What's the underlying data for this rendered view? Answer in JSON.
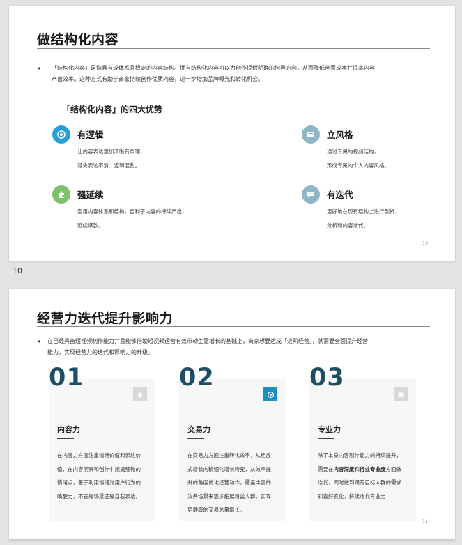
{
  "slide1": {
    "title": "做结构化内容",
    "bullet": "•",
    "paragraph_line1": "「结构化内容」是指具有成体系且稳定的内容结构。拥有结构化内容可以为创作提供明确的指导方向，从而降低创意成本并提高内容",
    "paragraph_line2": "产出效率。这种方式有助于商家持续创作优质内容，进一步增加品牌曝光和转化机会。",
    "subtitle": "「结构化内容」的四大优势",
    "features": [
      {
        "icon": "target-icon",
        "color": "#2a9fd6",
        "title": "有逻辑",
        "line1": "让内容表达更加清晰有条理，",
        "line2": "避免表达不清、逻辑混乱。"
      },
      {
        "icon": "card-icon",
        "color": "#8fb6c4",
        "title": "立风格",
        "line1": "通过专属的视频结构，",
        "line2": "形成专属的个人内容风格。"
      },
      {
        "icon": "puzzle-icon",
        "color": "#7cc36b",
        "title": "强延续",
        "line1": "套用内容体系和结构，更利于内容的持续产出，",
        "line2": "延续爆款。"
      },
      {
        "icon": "chat-icon",
        "color": "#8fb6c4",
        "title": "有迭代",
        "line1": "更好地在现有结构上进行剖析，",
        "line2": "分析和内容迭代。"
      }
    ],
    "page_number": "10"
  },
  "between_label": "10",
  "slide2": {
    "title": "经营力迭代提升影响力",
    "bullet": "•",
    "paragraph_line1": "在已经具备短视频制作能力并且能够借助短视频运营有效带动生意增长的基础上，商家想要达成「进阶经营」，就需要全面提升经营",
    "paragraph_line2": "能力，实现经营力的迭代和影响力的升级。",
    "cards": [
      {
        "number": "01",
        "icon": "puzzle-icon",
        "icon_bg": "#d9d9d9",
        "title": "内容力",
        "lines": [
          "在内容力方面注重情绪价值和表达价",
          "值，在内容洞察和创作中挖掘细微的",
          "情绪点，善于利用情绪对用户行为的",
          "唤醒力，不管是场景还是自我表达。"
        ]
      },
      {
        "number": "02",
        "icon": "target-icon",
        "icon_bg": "#1e8fc0",
        "title": "交易力",
        "lines": [
          "在交易力方面注重转化效率，从粗放",
          "式增长向精细化增长转变，从效率提",
          "升的角度优化经营动作，覆盖丰富的",
          "消费场景来逐步拓展粉丝人群，实现",
          "更健康的交易总量增长。"
        ]
      },
      {
        "number": "03",
        "icon": "card-icon",
        "icon_bg": "#d9d9d9",
        "title": "专业力",
        "line1": "除了本身内容制作能力的持续提升，",
        "line2_pre": "需要在",
        "line2_bold1": "内容深度",
        "line2_mid": "和",
        "line2_bold2": "行业专业度",
        "line2_post": "方面做",
        "line3": "迭代，同时做到跟踪目标人群的需求",
        "line4": "和喜好变化，持续迭代专业力"
      }
    ],
    "page_number": "11"
  }
}
